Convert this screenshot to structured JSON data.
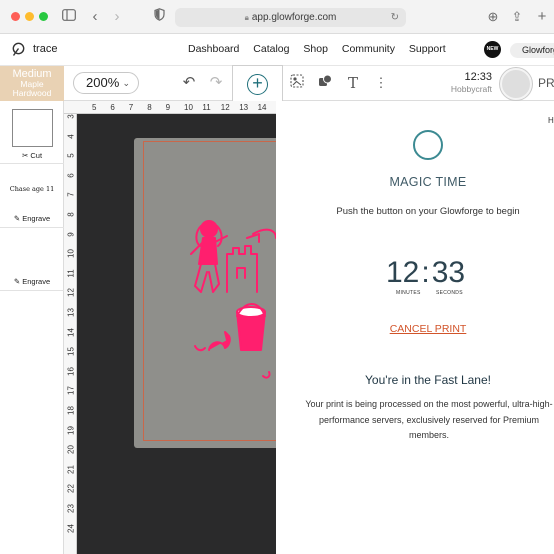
{
  "browser": {
    "url": "app.glowforge.com"
  },
  "nav": {
    "brand": "trace",
    "links": [
      "Dashboard",
      "Catalog",
      "Shop",
      "Community",
      "Support"
    ],
    "new_badge": "NEW",
    "machine_name": "Glowforge"
  },
  "toolbar": {
    "material_thickness": "Medium",
    "material_name": "Maple Hardwood",
    "zoom": "200%",
    "time": "12:33",
    "machine_label": "Hobbycraft",
    "print_label": "PRI"
  },
  "design_panel": {
    "operations": [
      {
        "label": "Cut",
        "icon": "cut-icon"
      },
      {
        "label": "Chase age 11",
        "type": "handwritten"
      },
      {
        "label": "Engrave",
        "icon": "pencil-icon"
      },
      {
        "label": "Engrave",
        "icon": "pencil-icon"
      }
    ]
  },
  "rulers": {
    "top": [
      "5",
      "6",
      "7",
      "8",
      "9",
      "10",
      "11",
      "12",
      "13",
      "14"
    ],
    "left": [
      "3",
      "4",
      "5",
      "6",
      "7",
      "8",
      "9",
      "10",
      "11",
      "12",
      "13",
      "14",
      "15",
      "16",
      "17",
      "18",
      "19",
      "20",
      "21",
      "22",
      "23",
      "24"
    ]
  },
  "print_modal": {
    "help_letter": "H",
    "title": "MAGIC TIME",
    "subtitle": "Push the button on your Glowforge to begin",
    "minutes": "12",
    "seconds": "33",
    "minutes_label": "MINUTES",
    "seconds_label": "SECONDS",
    "cancel": "CANCEL PRINT",
    "fast_lane_title": "You're in the Fast Lane!",
    "fast_lane_body": "Your print is being processed on the most powerful, ultra-high-performance servers, exclusively reserved for Premium members."
  },
  "colors": {
    "accent_teal": "#1f6f7a",
    "ring": "#3c8a92",
    "cancel": "#d2542a",
    "engrave_pink": "#ff1f6e",
    "material": "#e9d2b4"
  }
}
